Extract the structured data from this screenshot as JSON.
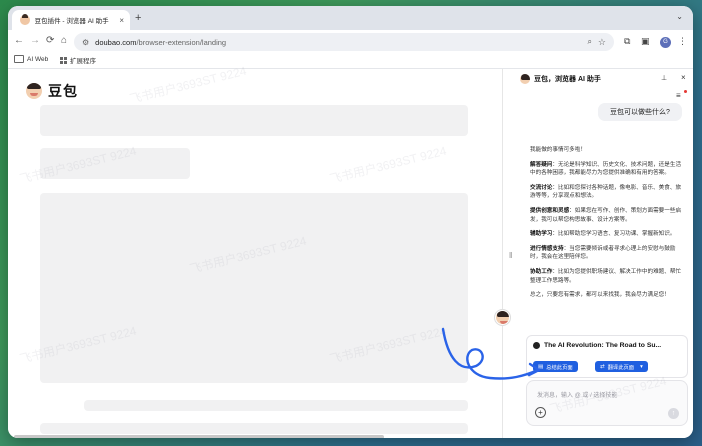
{
  "tab": {
    "title": "豆包插件 - 浏览器 AI 助手",
    "close": "×",
    "new": "+"
  },
  "nav": {
    "back": "←",
    "forward": "→",
    "reload": "⟳",
    "home": "⌂",
    "profile_initial": "G"
  },
  "omnibox": {
    "host": "doubao.com",
    "path": "/browser-extension/landing"
  },
  "bookmarks": [
    {
      "label": "AI Web"
    },
    {
      "label": "扩展程序"
    }
  ],
  "page": {
    "brand": "豆包"
  },
  "panel": {
    "title": "豆包，浏览器 AI 助手",
    "user_message": "豆包可以做些什么?",
    "reply": {
      "intro": "我能做的事情可多啦！",
      "items": [
        {
          "label": "解答疑问",
          "text": "：无论是科学知识、历史文化、技术问题，还是生活中的各种困惑，我都能尽力为您提供准确和有用的答案。"
        },
        {
          "label": "交流讨论",
          "text": "：比如和您探讨各种话题，像电影、音乐、美食、旅游等等，分享观点和想法。"
        },
        {
          "label": "提供创意和灵感",
          "text": "：如果您在写作、创作、策划方面需要一些启发，我可以帮您构思故事、设计方案等。"
        },
        {
          "label": "辅助学习",
          "text": "：比如帮助您学习语言、复习功课、掌握新知识。"
        },
        {
          "label": "进行情感支持",
          "text": "：当您需要倾诉或者寻求心理上的安慰与鼓励时，我会在这里陪伴您。"
        },
        {
          "label": "协助工作",
          "text": "：比如为您提供职场建议、解决工作中的难题、帮忙整理工作思路等。"
        }
      ],
      "outro": "总之，只要您有需求，都可以来找我，我会尽力满足您！"
    },
    "card": {
      "title": "The AI Revolution: The Road to Su...",
      "btn_summary": "总结此页面",
      "btn_translate": "翻译此页面"
    },
    "input": {
      "placeholder": "发消息，输入 @ 或 / 选择技能"
    }
  },
  "watermark": "飞书用户3693ST 9224"
}
